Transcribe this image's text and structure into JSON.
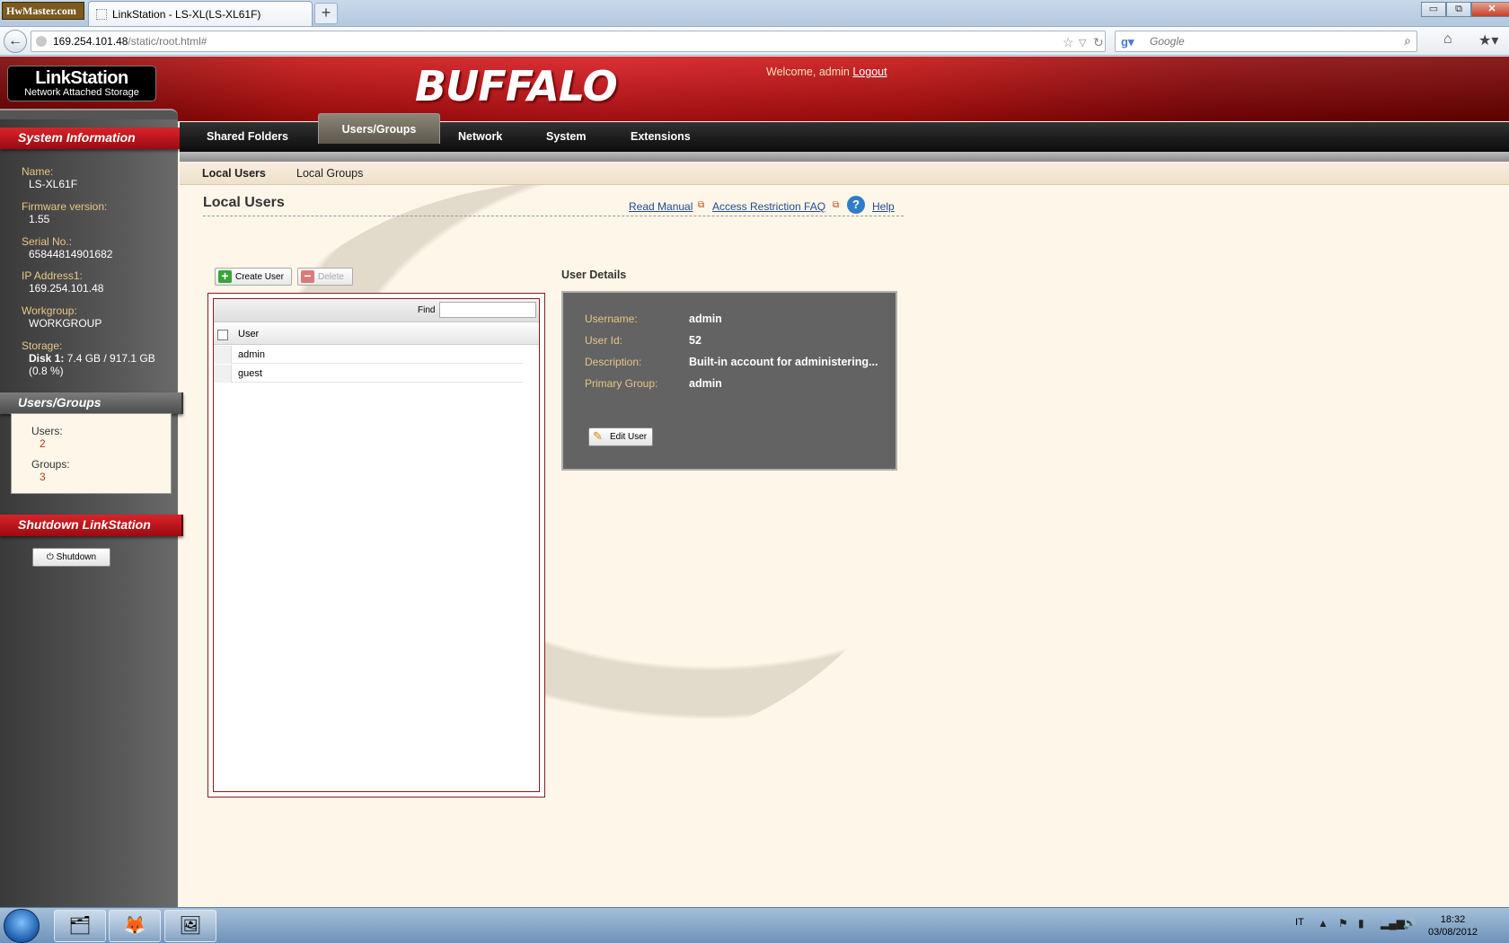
{
  "browser": {
    "badge": "HwMaster.com",
    "tab_title": "LinkStation - LS-XL(LS-XL61F)",
    "new_tab": "+",
    "url_host": "169.254.101.48",
    "url_path": "/static/root.html#",
    "search_placeholder": "Google",
    "window_buttons": {
      "minimize": "▭",
      "restore": "⧉",
      "close": "✕"
    }
  },
  "header": {
    "logo_title": "LinkStation",
    "logo_subtitle": "Network Attached Storage",
    "brand": "BUFFALO",
    "welcome": "Welcome, admin",
    "logout": "Logout"
  },
  "sidebar": {
    "system_info_title": "System Information",
    "info": [
      {
        "label": "Name:",
        "value": "LS-XL61F"
      },
      {
        "label": "Firmware version:",
        "value": "1.55"
      },
      {
        "label": "Serial No.:",
        "value": "65844814901682"
      },
      {
        "label": "IP Address1:",
        "value": "169.254.101.48"
      },
      {
        "label": "Workgroup:",
        "value": "WORKGROUP"
      }
    ],
    "storage_label": "Storage:",
    "storage_disk": "Disk 1:",
    "storage_value": "7.4 GB / 917.1 GB",
    "storage_percent": "(0.8 %)",
    "users_groups_title": "Users/Groups",
    "users_label": "Users:",
    "users_count": "2",
    "groups_label": "Groups:",
    "groups_count": "3",
    "shutdown_title": "Shutdown LinkStation",
    "shutdown_button": "Shutdown"
  },
  "main_tabs": [
    "Shared Folders",
    "Users/Groups",
    "Network",
    "System",
    "Extensions"
  ],
  "active_main_tab": "Users/Groups",
  "sub_tabs": [
    "Local Users",
    "Local Groups"
  ],
  "content": {
    "title": "Local Users",
    "read_manual": "Read Manual",
    "access_faq": "Access Restriction FAQ",
    "help": "Help",
    "create_user": "Create User",
    "delete": "Delete",
    "find_label": "Find",
    "column_user": "User",
    "users": [
      "admin",
      "guest"
    ]
  },
  "details": {
    "title": "User Details",
    "fields": [
      {
        "label": "Username:",
        "value": "admin"
      },
      {
        "label": "User Id:",
        "value": "52"
      },
      {
        "label": "Description:",
        "value": "Built-in account for administering..."
      },
      {
        "label": "Primary Group:",
        "value": "admin"
      }
    ],
    "edit_button": "Edit User"
  },
  "taskbar": {
    "language": "IT",
    "time": "18:32",
    "date": "03/08/2012"
  },
  "colors": {
    "header_red": "#c40d0d",
    "sidebar_red": "#d8242b",
    "content_bg": "#fdf6e9",
    "label_gold": "#e5c58a",
    "link_blue": "#1f4b8e"
  }
}
